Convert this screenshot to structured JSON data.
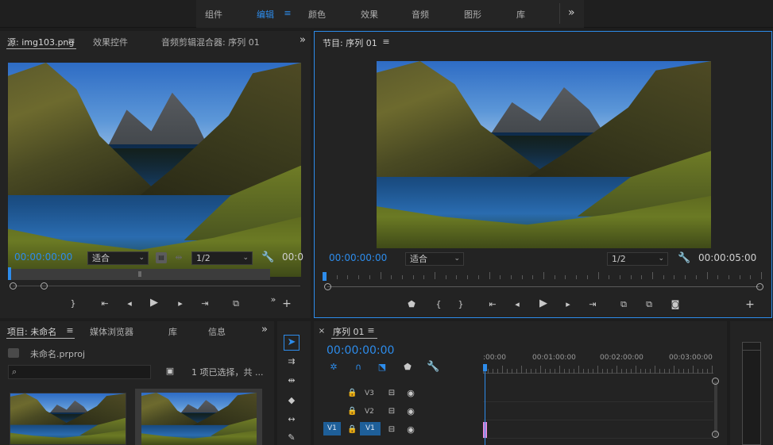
{
  "workspaces": {
    "items": [
      "组件",
      "编辑",
      "颜色",
      "效果",
      "音频",
      "图形",
      "库"
    ],
    "active_index": 1,
    "more": "»"
  },
  "source_panel": {
    "tabs": [
      "源: img103.png",
      "效果控件",
      "音频剪辑混合器: 序列 01"
    ],
    "more": "»",
    "timecode": "00:00:00:00",
    "fit": "适合",
    "resolution": "1/2",
    "timecode_right": "00:0"
  },
  "program_panel": {
    "title": "节目: 序列 01",
    "timecode": "00:00:00:00",
    "fit": "适合",
    "resolution": "1/2",
    "duration": "00:00:05:00"
  },
  "project_panel": {
    "tabs": [
      "项目: 未命名",
      "媒体浏览器",
      "库",
      "信息"
    ],
    "more": "»",
    "file": "未命名.prproj",
    "search_placeholder": "",
    "selection_info": "1 项已选择，共 ..."
  },
  "timeline": {
    "title": "序列 01",
    "timecode": "00:00:00:00",
    "ruler": [
      ":00:00",
      "00:01:00:00",
      "00:02:00:00",
      "00:03:00:00"
    ],
    "tracks": [
      {
        "label": "V3"
      },
      {
        "label": "V2"
      },
      {
        "label": "V1",
        "source": "V1"
      }
    ]
  },
  "colors": {
    "accent": "#2d8ceb",
    "panel": "#232323",
    "background": "#1d1d1d",
    "clip": "#e58bdc"
  }
}
